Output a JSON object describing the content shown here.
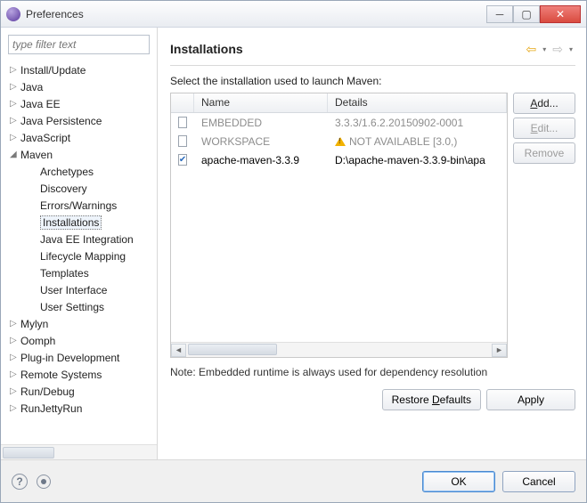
{
  "window": {
    "title": "Preferences"
  },
  "filter": {
    "placeholder": "type filter text"
  },
  "tree": {
    "items": [
      {
        "label": "Install/Update",
        "arrow": "▷",
        "level": 0
      },
      {
        "label": "Java",
        "arrow": "▷",
        "level": 0
      },
      {
        "label": "Java EE",
        "arrow": "▷",
        "level": 0
      },
      {
        "label": "Java Persistence",
        "arrow": "▷",
        "level": 0
      },
      {
        "label": "JavaScript",
        "arrow": "▷",
        "level": 0
      },
      {
        "label": "Maven",
        "arrow": "◢",
        "level": 0
      },
      {
        "label": "Archetypes",
        "arrow": "",
        "level": 1
      },
      {
        "label": "Discovery",
        "arrow": "",
        "level": 1
      },
      {
        "label": "Errors/Warnings",
        "arrow": "",
        "level": 1
      },
      {
        "label": "Installations",
        "arrow": "",
        "level": 1,
        "selected": true
      },
      {
        "label": "Java EE Integration",
        "arrow": "",
        "level": 1
      },
      {
        "label": "Lifecycle Mapping",
        "arrow": "",
        "level": 1
      },
      {
        "label": "Templates",
        "arrow": "",
        "level": 1
      },
      {
        "label": "User Interface",
        "arrow": "",
        "level": 1
      },
      {
        "label": "User Settings",
        "arrow": "",
        "level": 1
      },
      {
        "label": "Mylyn",
        "arrow": "▷",
        "level": 0
      },
      {
        "label": "Oomph",
        "arrow": "▷",
        "level": 0
      },
      {
        "label": "Plug-in Development",
        "arrow": "▷",
        "level": 0
      },
      {
        "label": "Remote Systems",
        "arrow": "▷",
        "level": 0
      },
      {
        "label": "Run/Debug",
        "arrow": "▷",
        "level": 0
      },
      {
        "label": "RunJettyRun",
        "arrow": "▷",
        "level": 0
      }
    ]
  },
  "main": {
    "title": "Installations",
    "select_label": "Select the installation used to launch Maven:",
    "columns": {
      "name": "Name",
      "details": "Details"
    },
    "rows": [
      {
        "checked": false,
        "disabled": true,
        "name": "EMBEDDED",
        "details": "3.3.3/1.6.2.20150902-0001",
        "warn": false
      },
      {
        "checked": false,
        "disabled": true,
        "name": "WORKSPACE",
        "details": "NOT AVAILABLE [3.0,)",
        "warn": true
      },
      {
        "checked": true,
        "disabled": false,
        "name": "apache-maven-3.3.9",
        "details": "D:\\apache-maven-3.3.9-bin\\apa",
        "warn": false
      }
    ],
    "buttons": {
      "add": "Add...",
      "edit": "Edit...",
      "remove": "Remove"
    },
    "note": "Note: Embedded runtime is always used for dependency resolution",
    "restore": "Restore Defaults",
    "apply": "Apply"
  },
  "footer": {
    "ok": "OK",
    "cancel": "Cancel"
  }
}
